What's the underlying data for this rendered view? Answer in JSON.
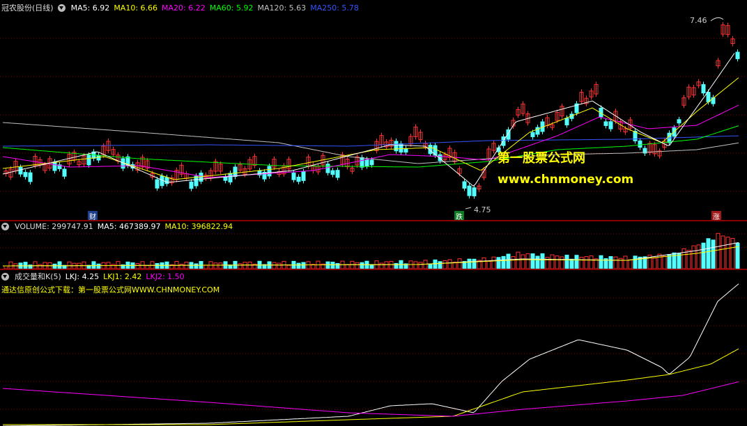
{
  "price_header": {
    "stock": "冠农股份(日线)",
    "ma5": "MA5: 6.92",
    "ma10": "MA10: 6.66",
    "ma20": "MA20: 6.22",
    "ma60": "MA60: 5.92",
    "ma120": "MA120: 5.63",
    "ma250": "MA250: 5.78"
  },
  "price_annotations": {
    "high_label": "7.46",
    "low_label": "4.75",
    "badge_cai": "财",
    "badge_die": "跌",
    "badge_zhang": "涨"
  },
  "watermark": {
    "site_name": "第一股票公式网",
    "url": "www.chnmoney.com"
  },
  "volume_header": {
    "volume": "VOLUME: 299747.91",
    "ma5": "MA5: 467389.97",
    "ma10": "MA10: 396822.94"
  },
  "indicator_header": {
    "name": "成交量和K(5)",
    "lkj": "LKJ: 4.25",
    "lkj1": "LKJ1: 2.42",
    "lkj2": "LKJ2: 1.50",
    "subtitle": "通达信原创公式下载：第一股票公式网WWW.CHNMONEY.COM"
  },
  "colors": {
    "up": "#ff3232",
    "down": "#54ffff",
    "ma5": "#ffffff",
    "ma10": "#ffff00",
    "ma20": "#ff00ff",
    "ma60": "#00ff00",
    "ma120": "#c0c0c0",
    "ma250": "#3355ff",
    "grid": "#8b0000"
  },
  "icons": [
    "collapse-arrow-icon"
  ]
}
